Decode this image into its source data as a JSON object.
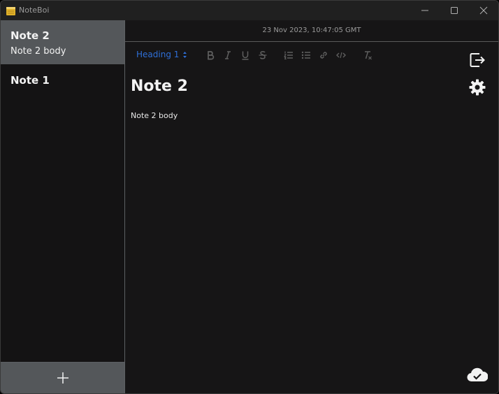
{
  "window": {
    "title": "NoteBoi"
  },
  "sidebar": {
    "notes": [
      {
        "title": "Note 2",
        "snippet": "Note 2 body",
        "selected": true
      },
      {
        "title": "Note 1",
        "snippet": "",
        "selected": false
      }
    ],
    "add_icon": "plus-icon"
  },
  "editor": {
    "timestamp": "23 Nov 2023, 10:47:05 GMT",
    "toolbar": {
      "heading_selected": "Heading 1",
      "buttons": [
        "bold",
        "italic",
        "underline",
        "strikethrough",
        "ordered-list",
        "bullet-list",
        "link",
        "code",
        "clear-format"
      ]
    },
    "document": {
      "title": "Note 2",
      "body": "Note 2 body"
    },
    "side_icons": [
      "export-icon",
      "gear-icon"
    ],
    "status_icon": "cloud-check-icon"
  },
  "colors": {
    "accent": "#2f6fd8",
    "selected_note_bg": "#54575a",
    "editor_bg": "#161516"
  }
}
